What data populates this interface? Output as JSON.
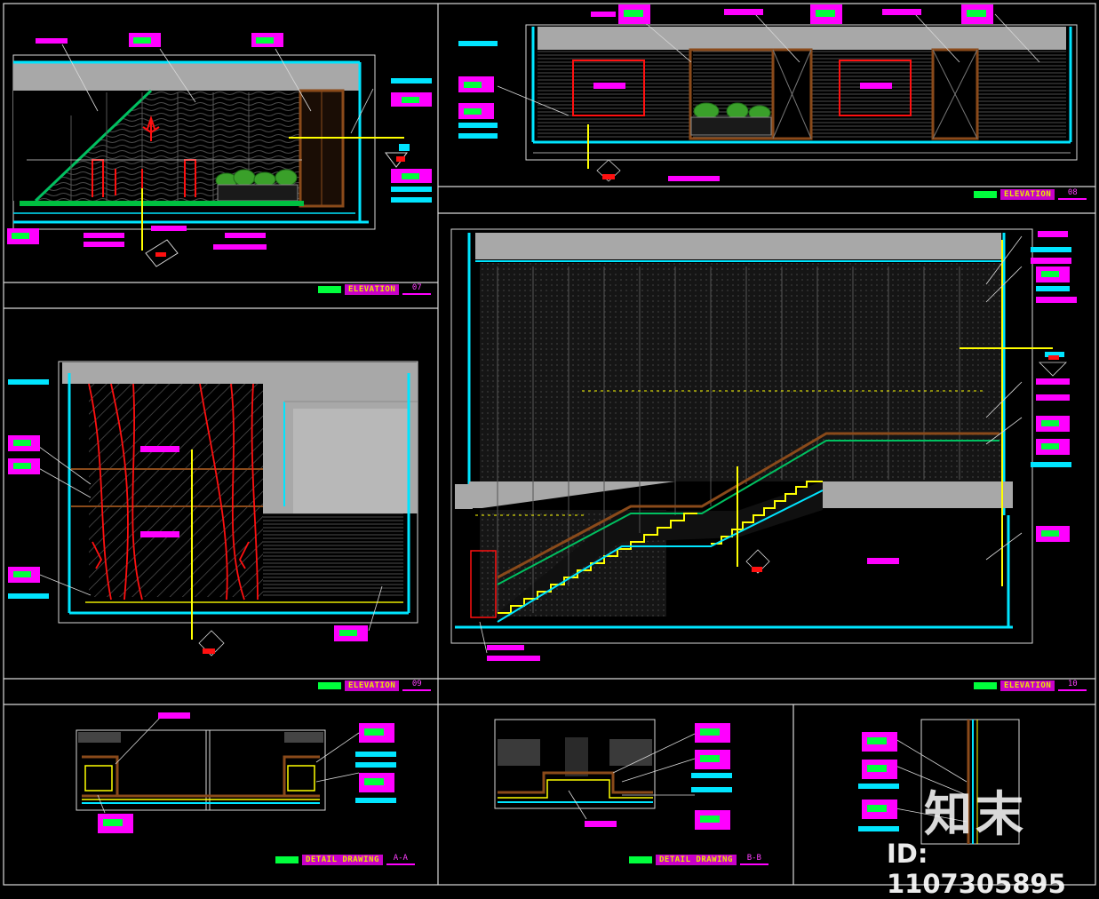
{
  "drawing": {
    "colors": {
      "frame": "#d8d8d8",
      "magenta": "#ff00ff",
      "green": "#00ff3c",
      "cyan": "#00e5ff",
      "yellow": "#ffff00",
      "red": "#ff1010",
      "wood": "#8a4a1a",
      "grey": "#a8a8a8",
      "gridline": "#5a5a5a"
    },
    "views": [
      {
        "title": "ELEVATION",
        "number": "07"
      },
      {
        "title": "ELEVATION",
        "number": "08"
      },
      {
        "title": "ELEVATION",
        "number": "09"
      },
      {
        "title": "ELEVATION",
        "number": "10"
      },
      {
        "title": "DETAIL DRAWING",
        "number": "A-A"
      },
      {
        "title": "DETAIL DRAWING",
        "number": "B-B"
      }
    ]
  },
  "watermark": {
    "logo": "知末",
    "id_text": "ID: 1107305895"
  }
}
